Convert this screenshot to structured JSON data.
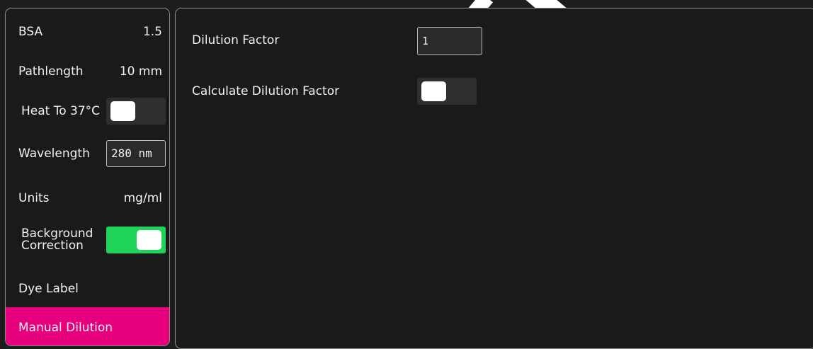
{
  "sidebar": {
    "bsa": {
      "label": "BSA",
      "value": "1.5"
    },
    "pathlength": {
      "label": "Pathlength",
      "value": "10 mm"
    },
    "heat": {
      "label": "Heat To 37°C",
      "toggle_state": "off"
    },
    "wavelength": {
      "label": "Wavelength",
      "value": "280 nm"
    },
    "units": {
      "label": "Units",
      "value": "mg/ml"
    },
    "background_correction": {
      "label_line1": "Background",
      "label_line2": "Correction",
      "toggle_state": "on"
    },
    "dye_label": {
      "label": "Dye Label"
    },
    "manual_dilution": {
      "label": "Manual Dilution",
      "selected": true
    }
  },
  "main": {
    "dilution_factor": {
      "label": "Dilution Factor",
      "value": "1"
    },
    "calculate_dilution_factor": {
      "label": "Calculate Dilution Factor",
      "toggle_state": "off"
    }
  },
  "watermark": {
    "text": "FISHER SA"
  },
  "colors": {
    "accent_selected": "#e6007e",
    "toggle_on": "#1fd25a",
    "toggle_off": "#2f2f2f",
    "background": "#1e1e1e"
  }
}
